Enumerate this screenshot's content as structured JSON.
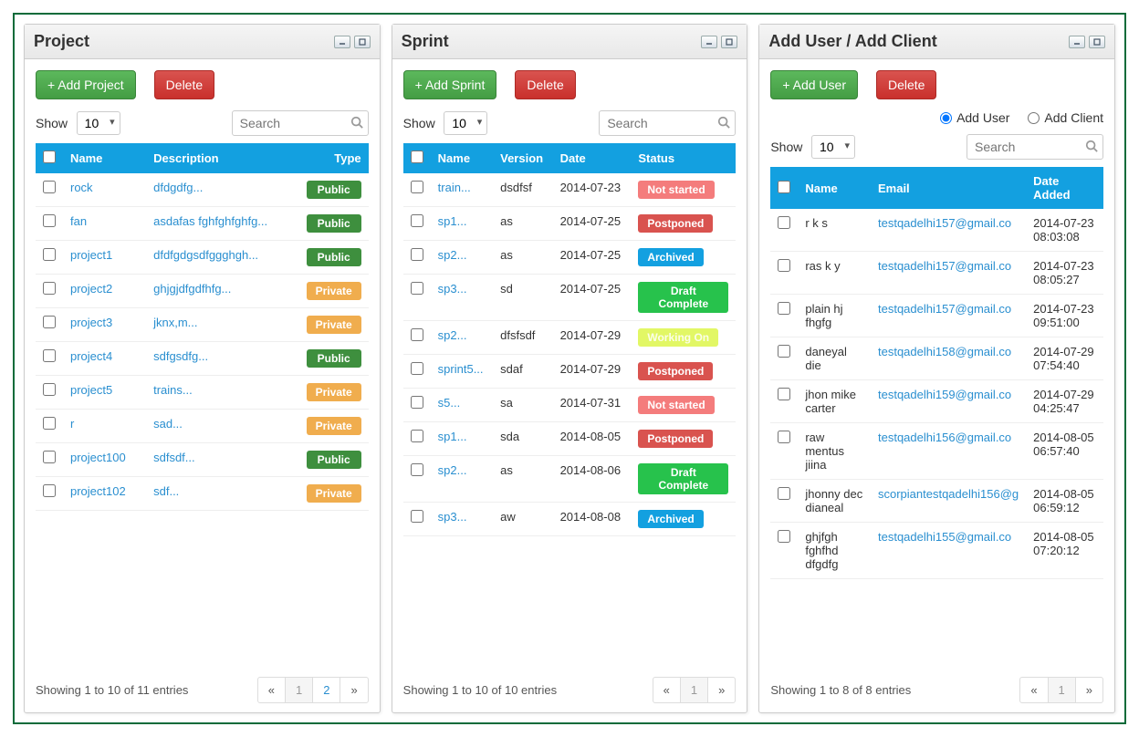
{
  "common": {
    "show_label": "Show",
    "show_value": "10",
    "search_placeholder": "Search",
    "prev_label": "«",
    "next_label": "»"
  },
  "project": {
    "title": "Project",
    "add_label": "+ Add Project",
    "delete_label": "Delete",
    "headers": {
      "name": "Name",
      "description": "Description",
      "type": "Type"
    },
    "rows": [
      {
        "name": "rock",
        "desc": "dfdgdfg...",
        "type": "Public"
      },
      {
        "name": "fan",
        "desc": "asdafas fghfghfghfg...",
        "type": "Public"
      },
      {
        "name": "project1",
        "desc": "dfdfgdgsdfggghgh...",
        "type": "Public"
      },
      {
        "name": "project2",
        "desc": "ghjgjdfgdfhfg...",
        "type": "Private"
      },
      {
        "name": "project3",
        "desc": "jknx,m...",
        "type": "Private"
      },
      {
        "name": "project4",
        "desc": "sdfgsdfg...",
        "type": "Public"
      },
      {
        "name": "project5",
        "desc": "trains...",
        "type": "Private"
      },
      {
        "name": "r",
        "desc": "sad...",
        "type": "Private"
      },
      {
        "name": "project100",
        "desc": "sdfsdf...",
        "type": "Public"
      },
      {
        "name": "project102",
        "desc": "sdf...",
        "type": "Private"
      }
    ],
    "footer_text": "Showing 1 to 10 of 11 entries",
    "pages": [
      "1",
      "2"
    ]
  },
  "sprint": {
    "title": "Sprint",
    "add_label": "+ Add Sprint",
    "delete_label": "Delete",
    "headers": {
      "name": "Name",
      "version": "Version",
      "date": "Date",
      "status": "Status"
    },
    "rows": [
      {
        "name": "train...",
        "version": "dsdfsf",
        "date": "2014-07-23",
        "status": "Not started",
        "cls": "s-notstarted"
      },
      {
        "name": "sp1...",
        "version": "as",
        "date": "2014-07-25",
        "status": "Postponed",
        "cls": "s-postponed"
      },
      {
        "name": "sp2...",
        "version": "as",
        "date": "2014-07-25",
        "status": "Archived",
        "cls": "s-archived"
      },
      {
        "name": "sp3...",
        "version": "sd",
        "date": "2014-07-25",
        "status": "Draft Complete",
        "cls": "s-draft"
      },
      {
        "name": "sp2...",
        "version": "dfsfsdf",
        "date": "2014-07-29",
        "status": "Working On",
        "cls": "s-working"
      },
      {
        "name": "sprint5...",
        "version": "sdaf",
        "date": "2014-07-29",
        "status": "Postponed",
        "cls": "s-postponed"
      },
      {
        "name": "s5...",
        "version": "sa",
        "date": "2014-07-31",
        "status": "Not started",
        "cls": "s-notstarted"
      },
      {
        "name": "sp1...",
        "version": "sda",
        "date": "2014-08-05",
        "status": "Postponed",
        "cls": "s-postponed"
      },
      {
        "name": "sp2...",
        "version": "as",
        "date": "2014-08-06",
        "status": "Draft Complete",
        "cls": "s-draft"
      },
      {
        "name": "sp3...",
        "version": "aw",
        "date": "2014-08-08",
        "status": "Archived",
        "cls": "s-archived"
      }
    ],
    "footer_text": "Showing 1 to 10 of 10 entries",
    "pages": [
      "1"
    ]
  },
  "user": {
    "title": "Add User / Add Client",
    "add_label": "+ Add User",
    "delete_label": "Delete",
    "radio1": "Add User",
    "radio2": "Add Client",
    "headers": {
      "name": "Name",
      "email": "Email",
      "date": "Date Added"
    },
    "rows": [
      {
        "name": "r k s",
        "email": "testqadelhi157@gmail.co",
        "date": "2014-07-23 08:03:08"
      },
      {
        "name": "ras k y",
        "email": "testqadelhi157@gmail.co",
        "date": "2014-07-23 08:05:27"
      },
      {
        "name": "plain hj fhgfg",
        "email": "testqadelhi157@gmail.co",
        "date": "2014-07-23 09:51:00"
      },
      {
        "name": "daneyal die",
        "email": "testqadelhi158@gmail.co",
        "date": "2014-07-29 07:54:40"
      },
      {
        "name": "jhon mike carter",
        "email": "testqadelhi159@gmail.co",
        "date": "2014-07-29 04:25:47"
      },
      {
        "name": "raw mentus jiina",
        "email": "testqadelhi156@gmail.co",
        "date": "2014-08-05 06:57:40"
      },
      {
        "name": "jhonny dec dianeal",
        "email": "scorpiantestqadelhi156@g",
        "date": "2014-08-05 06:59:12"
      },
      {
        "name": "ghjfgh fghfhd dfgdfg",
        "email": "testqadelhi155@gmail.co",
        "date": "2014-08-05 07:20:12"
      }
    ],
    "footer_text": "Showing 1 to 8 of 8 entries",
    "pages": [
      "1"
    ]
  }
}
